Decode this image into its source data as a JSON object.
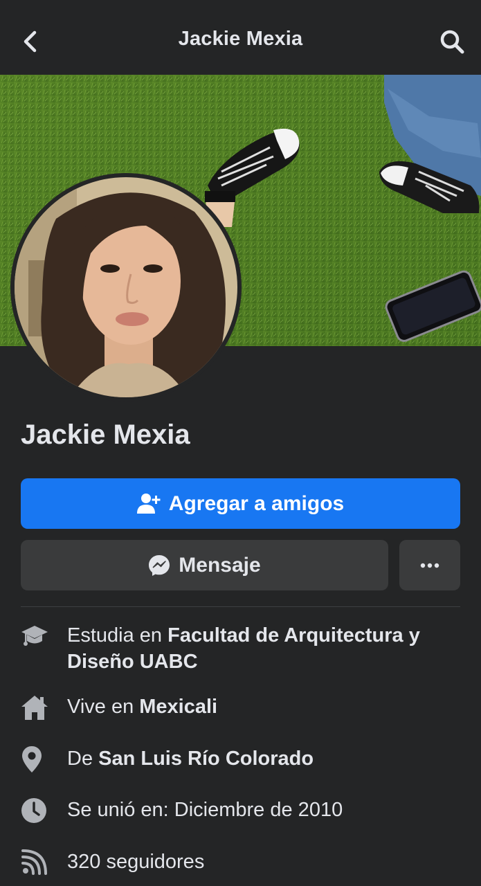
{
  "header": {
    "title": "Jackie Mexia",
    "back_icon": "chevron-left-icon",
    "search_icon": "search-icon"
  },
  "profile": {
    "name": "Jackie Mexia"
  },
  "actions": {
    "add_friend_label": "Agregar a amigos",
    "message_label": "Mensaje",
    "more_icon": "more-horizontal-icon"
  },
  "details": [
    {
      "icon": "graduation-cap-icon",
      "prefix": "Estudia en ",
      "value": "Facultad de Arquitectura y Diseño UABC"
    },
    {
      "icon": "home-icon",
      "prefix": "Vive en ",
      "value": "Mexicali"
    },
    {
      "icon": "location-pin-icon",
      "prefix": "De ",
      "value": "San Luis Río Colorado"
    },
    {
      "icon": "clock-icon",
      "prefix": "Se unió en: Diciembre de 2010",
      "value": ""
    },
    {
      "icon": "followers-icon",
      "prefix": "320 seguidores",
      "value": ""
    }
  ],
  "colors": {
    "background": "#242526",
    "primary_button": "#1877f2",
    "secondary_button": "#3a3b3c",
    "text": "#e4e6eb",
    "icon": "#b0b3b8"
  }
}
